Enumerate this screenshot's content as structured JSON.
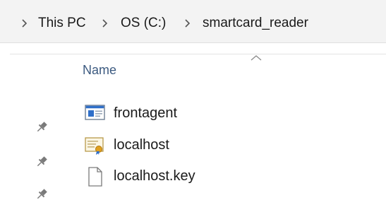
{
  "breadcrumb": {
    "items": [
      {
        "label": "This PC"
      },
      {
        "label": "OS (C:)"
      },
      {
        "label": "smartcard_reader"
      }
    ]
  },
  "columns": {
    "name": "Name",
    "sort_indicator": "ascending"
  },
  "files": [
    {
      "name": "frontagent",
      "icon": "application-icon"
    },
    {
      "name": "localhost",
      "icon": "certificate-icon"
    },
    {
      "name": "localhost.key",
      "icon": "blank-file-icon"
    }
  ],
  "quick_access": {
    "pins": [
      "pin-icon",
      "pin-icon",
      "pin-icon"
    ]
  }
}
